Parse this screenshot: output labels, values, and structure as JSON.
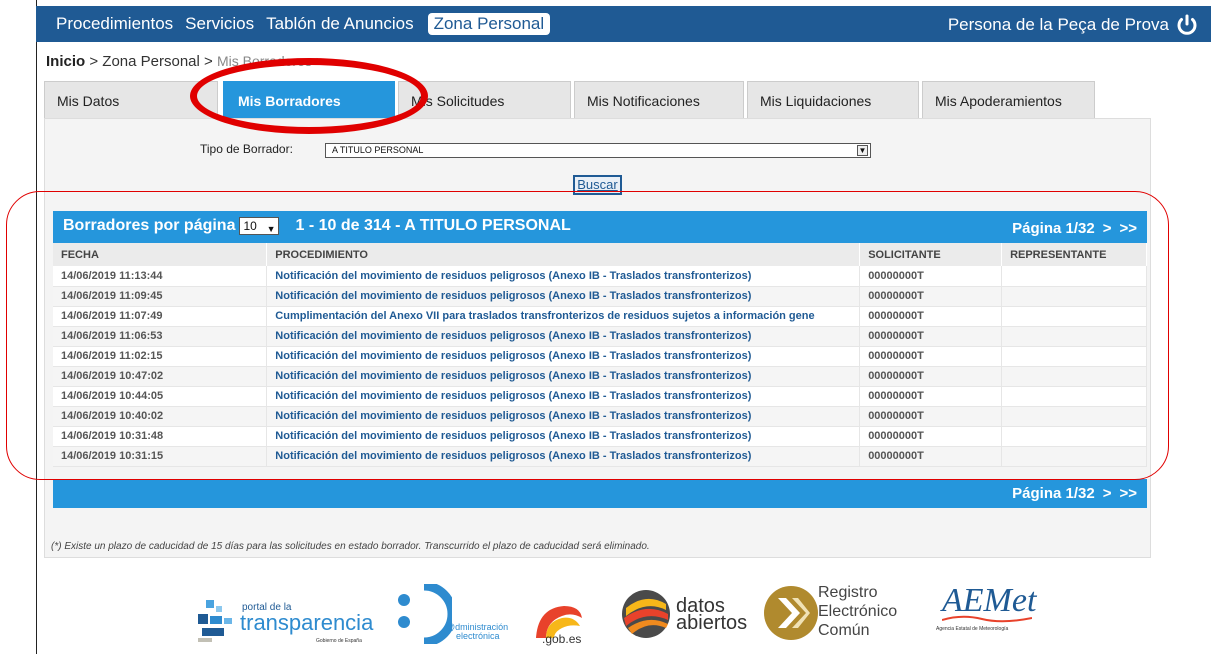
{
  "topbar": {
    "nav": [
      "Procedimientos",
      "Servicios",
      "Tablón de Anuncios"
    ],
    "active": "Zona Personal",
    "user": "Persona de la Peça de Prova"
  },
  "breadcrumb": {
    "home": "Inicio",
    "sep1": ">",
    "section": "Zona Personal",
    "sep2": ">",
    "current": "Mis Borradores",
    "sep3": ">"
  },
  "tabs": [
    "Mis Datos",
    "Mis Borradores",
    "Mis Solicitudes",
    "Mis Notificaciones",
    "Mis Liquidaciones",
    "Mis Apoderamientos"
  ],
  "filter": {
    "label": "Tipo de Borrador:",
    "value": "A TITULO PERSONAL",
    "button": "Buscar"
  },
  "table": {
    "per_page_label": "Borradores por página",
    "per_page_value": "10",
    "range": "1 - 10 de 314 - A TITULO PERSONAL",
    "page": "Página 1/32",
    "next": ">",
    "last": ">>",
    "columns": [
      "FECHA",
      "PROCEDIMIENTO",
      "SOLICITANTE",
      "REPRESENTANTE"
    ],
    "rows": [
      [
        "14/06/2019 11:13:44",
        "Notificación del movimiento de residuos peligrosos (Anexo IB - Traslados transfronterizos)",
        "00000000T",
        ""
      ],
      [
        "14/06/2019 11:09:45",
        "Notificación del movimiento de residuos peligrosos (Anexo IB - Traslados transfronterizos)",
        "00000000T",
        ""
      ],
      [
        "14/06/2019 11:07:49",
        "Cumplimentación del Anexo VII para traslados transfronterizos de residuos sujetos a información gene",
        "00000000T",
        ""
      ],
      [
        "14/06/2019 11:06:53",
        "Notificación del movimiento de residuos peligrosos (Anexo IB - Traslados transfronterizos)",
        "00000000T",
        ""
      ],
      [
        "14/06/2019 11:02:15",
        "Notificación del movimiento de residuos peligrosos (Anexo IB - Traslados transfronterizos)",
        "00000000T",
        ""
      ],
      [
        "14/06/2019 10:47:02",
        "Notificación del movimiento de residuos peligrosos (Anexo IB - Traslados transfronterizos)",
        "00000000T",
        ""
      ],
      [
        "14/06/2019 10:44:05",
        "Notificación del movimiento de residuos peligrosos (Anexo IB - Traslados transfronterizos)",
        "00000000T",
        ""
      ],
      [
        "14/06/2019 10:40:02",
        "Notificación del movimiento de residuos peligrosos (Anexo IB - Traslados transfronterizos)",
        "00000000T",
        ""
      ],
      [
        "14/06/2019 10:31:48",
        "Notificación del movimiento de residuos peligrosos (Anexo IB - Traslados transfronterizos)",
        "00000000T",
        ""
      ],
      [
        "14/06/2019 10:31:15",
        "Notificación del movimiento de residuos peligrosos (Anexo IB - Traslados transfronterizos)",
        "00000000T",
        ""
      ]
    ]
  },
  "note": "(*) Existe un plazo de caducidad de 15 días para las solicitudes en estado borrador. Transcurrido el plazo de caducidad será eliminado.",
  "logos": {
    "transparencia_small": "portal de la",
    "transparencia_big": "transparencia",
    "transparencia_sub": "Gobierno de España",
    "admin_line1": "@dministración",
    "admin_line2": "electrónica",
    "gobes": ".gob.es",
    "datos1": "datos",
    "datos2": "abiertos",
    "registro1": "Registro",
    "registro2": "Electrónico",
    "registro3": "Común",
    "aemet": "AEMet",
    "aemet_sub": "Agencia Estatal de Meteorología"
  },
  "colors": {
    "topbar": "#1f5a94",
    "accent": "#2596dc",
    "annotation": "#e00000"
  }
}
